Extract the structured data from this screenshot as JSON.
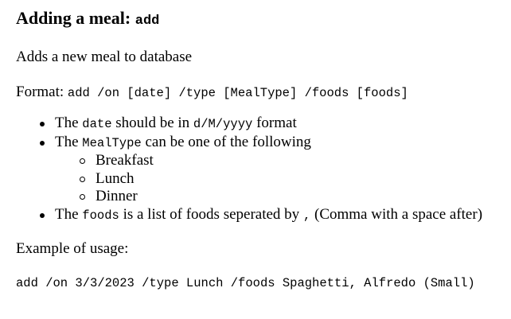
{
  "heading": {
    "text": "Adding a meal:",
    "command": "add"
  },
  "description": "Adds a new meal to database",
  "format": {
    "label": "Format:",
    "syntax": "add /on [date] /type [MealType] /foods [foods]"
  },
  "bullets": {
    "date": {
      "pre": "The",
      "code": "date",
      "mid": "should be in",
      "format_code": "d/M/yyyy",
      "post": "format"
    },
    "mealtype": {
      "pre": "The",
      "code": "MealType",
      "post": "can be one of the following",
      "options": [
        "Breakfast",
        "Lunch",
        "Dinner"
      ]
    },
    "foods": {
      "pre": "The",
      "code": "foods",
      "mid": "is a list of foods seperated by",
      "sep_code": ",",
      "post": "(Comma with a space after)"
    }
  },
  "example": {
    "label": "Example of usage:",
    "code": "add /on 3/3/2023 /type Lunch /foods Spaghetti, Alfredo (Small)"
  }
}
